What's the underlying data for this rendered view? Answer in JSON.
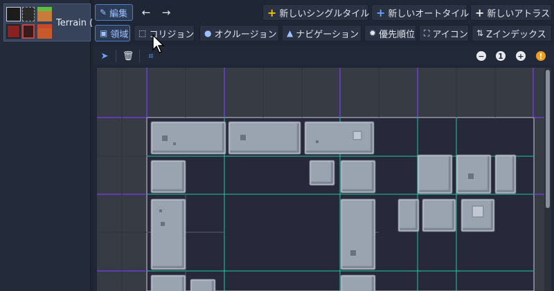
{
  "tileset_panel": {
    "item_label": "Terrain ("
  },
  "toolbar_top": {
    "edit_label": "編集",
    "back_icon": "arrow-left-icon",
    "forward_icon": "arrow-right-icon",
    "new_single_tile": "新しいシングルタイル",
    "new_autotile": "新しいオートタイル",
    "new_atlas": "新しいアトラス"
  },
  "toolbar_modes": {
    "region": "領域",
    "collision": "コリジョン",
    "occlusion": "オクルージョン",
    "navigation": "ナビゲーション",
    "priority": "優先順位",
    "icon": "アイコン",
    "z_index": "Zインデックス"
  },
  "toolbar_tools": {
    "zoom_reset_label": "1",
    "info_label": "!"
  },
  "colors": {
    "accent": "#4f7fc8",
    "grid_purple": "#7a3df0",
    "grid_teal": "#1fc9a4",
    "region_bg": "#27283a"
  }
}
